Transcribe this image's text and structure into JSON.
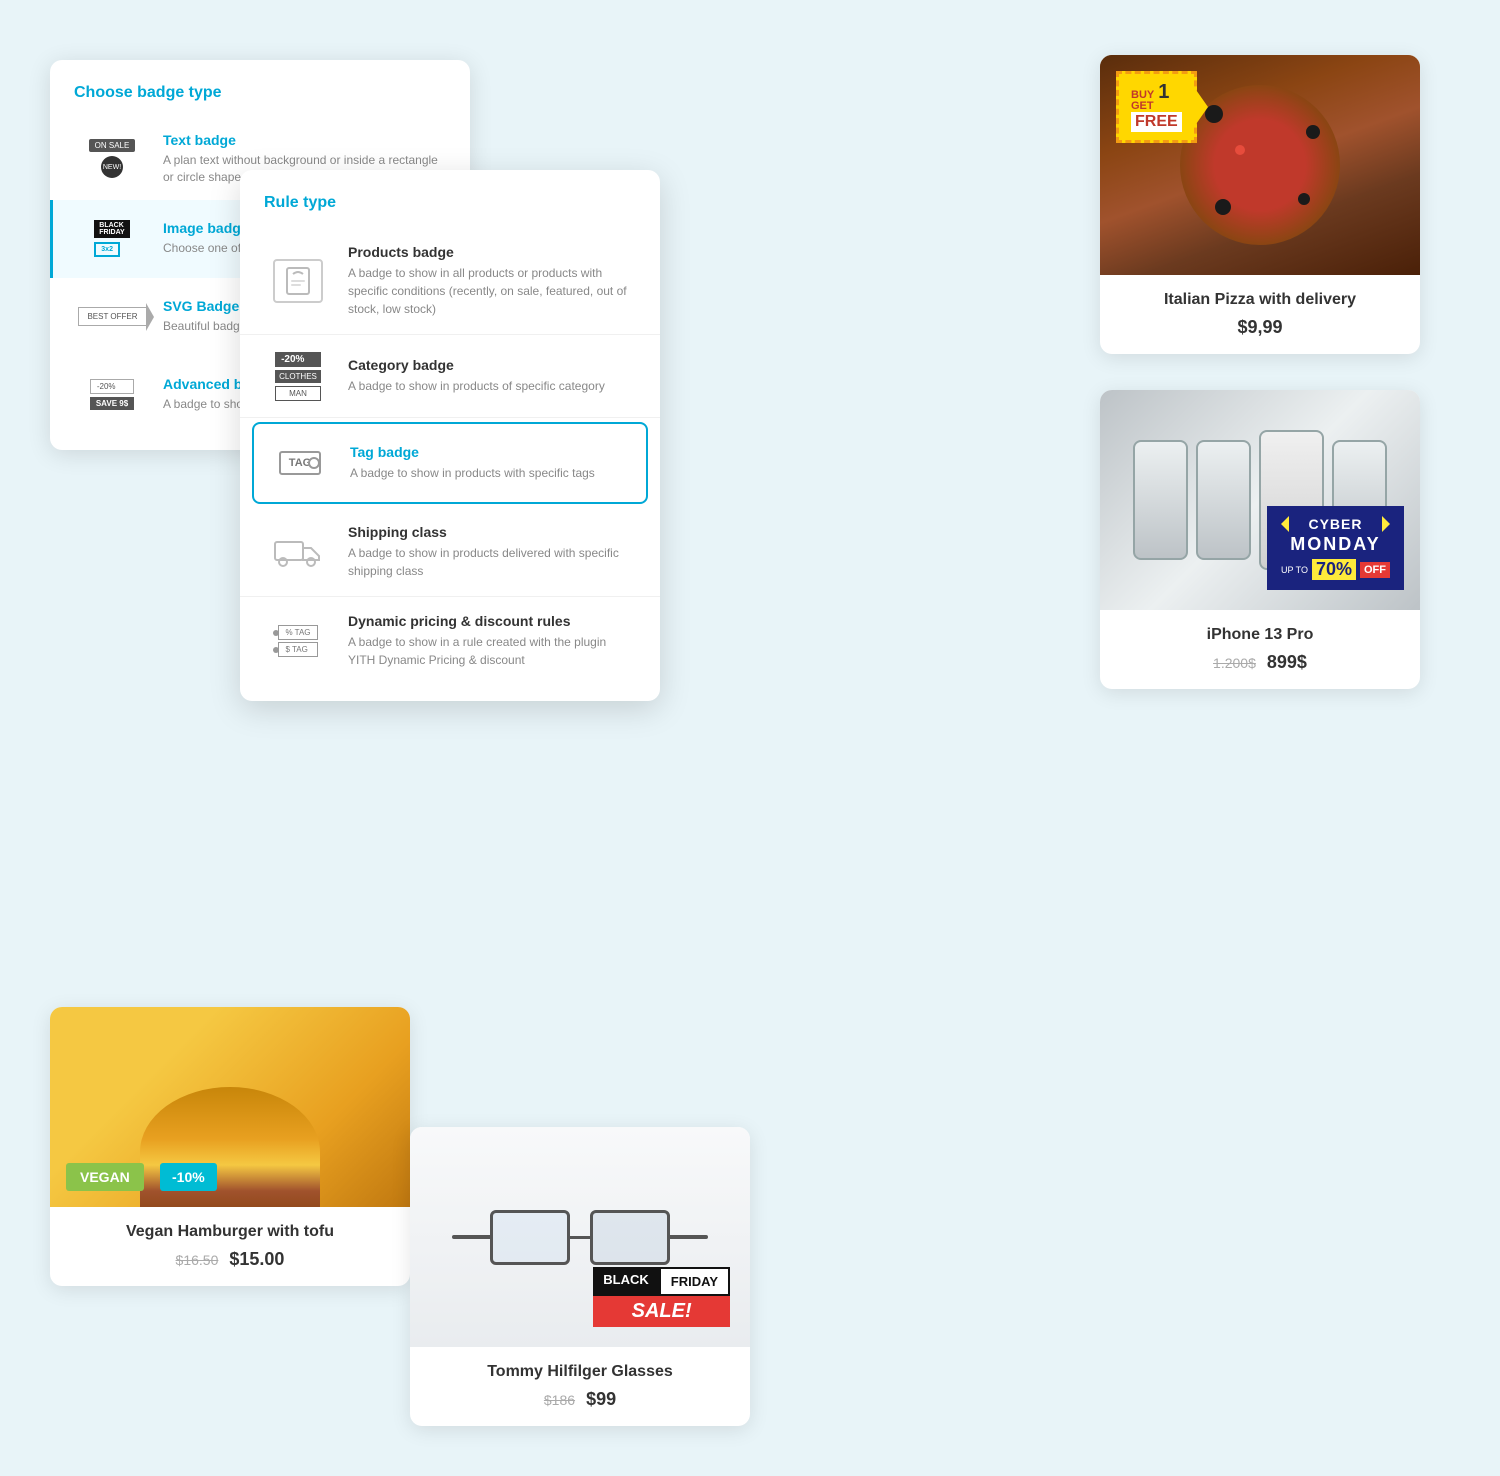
{
  "page": {
    "background": "#e8f4f8"
  },
  "badge_type_panel": {
    "title": "Choose badge type",
    "items": [
      {
        "id": "text",
        "label": "Text badge",
        "description": "A plan text without background or inside a rectangle or circle shape",
        "active": false
      },
      {
        "id": "image",
        "label": "Image badge",
        "description": "Choose one of the b...",
        "active": true
      },
      {
        "id": "svg",
        "label": "SVG Badge",
        "description": "Beautiful badges fully...",
        "active": false
      },
      {
        "id": "advanced",
        "label": "Advanced badge f...",
        "description": "A badge to show the regular price and sa...",
        "active": false
      }
    ]
  },
  "rule_type_panel": {
    "title": "Rule type",
    "items": [
      {
        "id": "products",
        "label": "Products badge",
        "description": "A badge to show in all products or products with specific conditions (recently, on sale, featured, out of stock, low stock)",
        "active": false
      },
      {
        "id": "category",
        "label": "Category badge",
        "description": "A badge to show in products of specific category",
        "active": false
      },
      {
        "id": "tag",
        "label": "Tag badge",
        "description": "A badge to show in products with specific tags",
        "active": true
      },
      {
        "id": "shipping",
        "label": "Shipping class",
        "description": "A badge to show in products delivered with specific shipping class",
        "active": false
      },
      {
        "id": "dynamic",
        "label": "Dynamic pricing & discount rules",
        "description": "A badge to show in a rule created with the plugin YITH Dynamic Pricing & discount",
        "active": false
      }
    ]
  },
  "products": {
    "pizza": {
      "name": "Italian Pizza with delivery",
      "price": "$9,99",
      "badge": {
        "line1_buy": "BUY",
        "line1_get": "GET",
        "number": "1",
        "line2": "FREE"
      }
    },
    "iphone": {
      "name": "iPhone 13 Pro",
      "price_old": "1.200$",
      "price_new": "899$",
      "badge": {
        "cyber": "CYBER",
        "monday": "MONDAY",
        "up_to": "UP TO",
        "percent": "70%",
        "off": "OFF"
      }
    },
    "hamburger": {
      "name": "Vegan Hamburger with tofu",
      "price_old": "$16.50",
      "price_new": "$15.00",
      "badges": [
        "VEGAN",
        "-10%"
      ]
    },
    "glasses": {
      "name": "Tommy Hilfilger Glasses",
      "price_old": "$186",
      "price_new": "$99",
      "badge": {
        "black": "BLACK",
        "friday": "FRIDAY",
        "sale": "SALE!"
      }
    }
  }
}
